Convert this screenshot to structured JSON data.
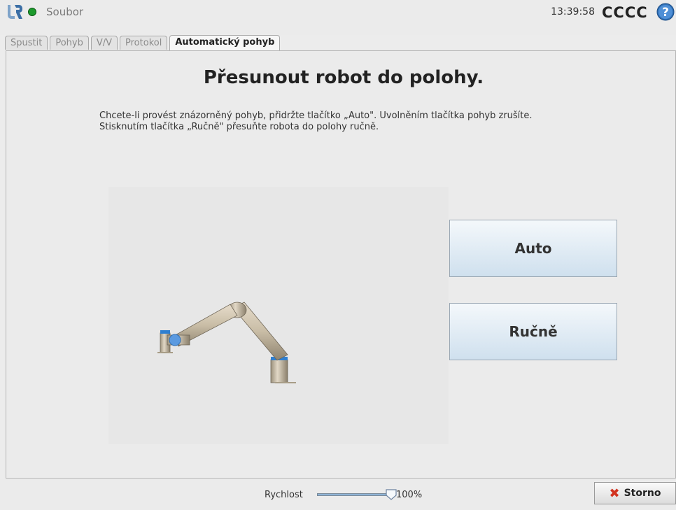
{
  "header": {
    "file_label": "Soubor",
    "time": "13:39:58",
    "robot_name": "CCCC"
  },
  "tabs": [
    {
      "label": "Spustit",
      "active": false
    },
    {
      "label": "Pohyb",
      "active": false
    },
    {
      "label": "V/V",
      "active": false
    },
    {
      "label": "Protokol",
      "active": false
    },
    {
      "label": "Automatický pohyb",
      "active": true
    }
  ],
  "main": {
    "title": "Přesunout robot do polohy.",
    "description_line1": "Chcete-li provést znázorněný pohyb, přidržte tlačítko „Auto\". Uvolněním tlačítka pohyb zrušíte.",
    "description_line2": "Stisknutím tlačítka „Ručně\" přesuňte robota do polohy ručně.",
    "auto_button": "Auto",
    "manual_button": "Ručně"
  },
  "footer": {
    "speed_label": "Rychlost",
    "speed_value": "100%",
    "speed_fraction": 1.0,
    "cancel_label": "Storno"
  },
  "colors": {
    "status_ok": "#1c9a2c",
    "help_icon": "#2f6fb5",
    "cancel_icon": "#d2321f"
  }
}
